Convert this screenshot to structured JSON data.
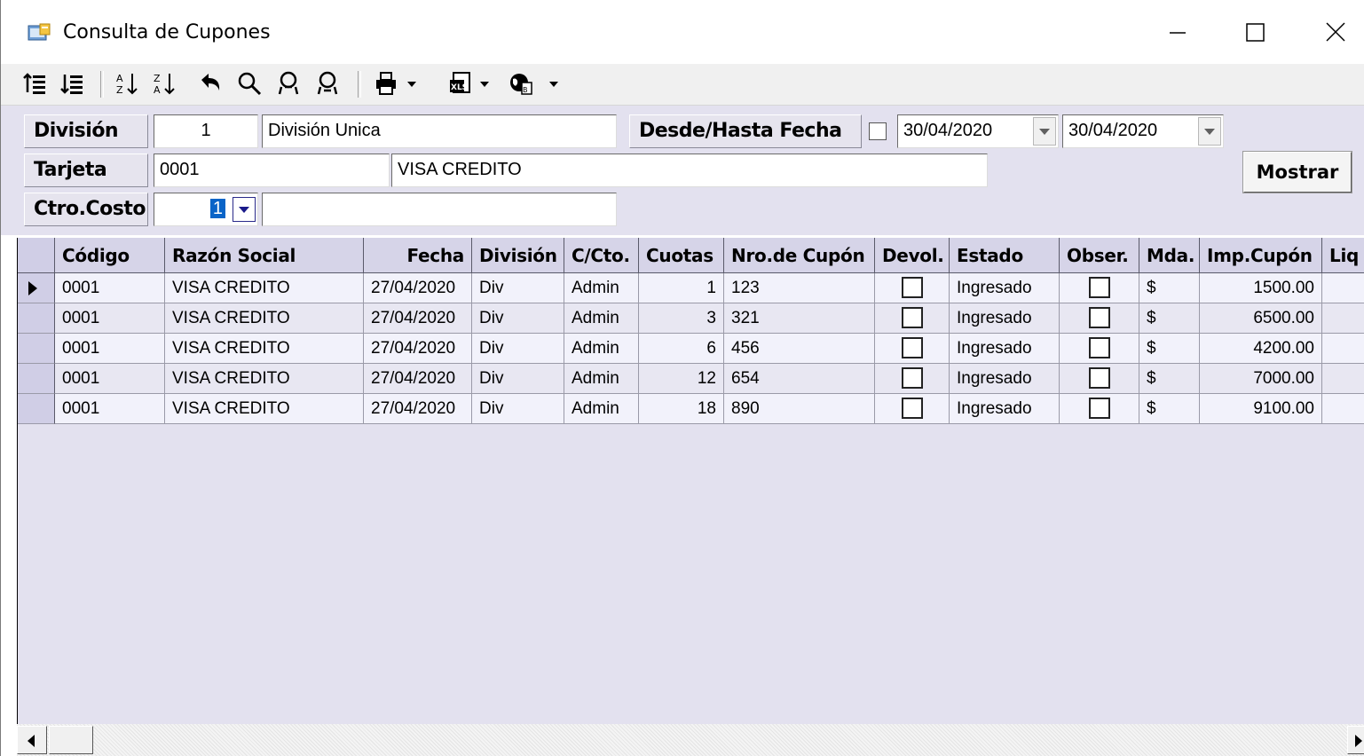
{
  "window": {
    "title": "Consulta de Cupones",
    "icons": {
      "app": "app-window-icon",
      "minimize": "minimize-icon",
      "maximize": "maximize-icon",
      "close": "close-icon"
    }
  },
  "toolbar": {
    "icons": [
      "indent-left-icon",
      "indent-right-icon",
      "sort-ascending-icon",
      "sort-descending-icon",
      "undo-icon",
      "find-icon",
      "find-all-icon",
      "find-next-icon",
      "print-icon",
      "export-excel-icon",
      "web-export-icon"
    ]
  },
  "filters": {
    "division_label": "División",
    "division_code": "1",
    "division_name": "División Unica",
    "date_range_label": "Desde/Hasta Fecha",
    "date_from": "30/04/2020",
    "date_to": "30/04/2020",
    "card_label": "Tarjeta",
    "card_code": "0001",
    "card_name": "VISA CREDITO",
    "cost_center_label": "Ctro.Costo",
    "cost_center_value": "1",
    "cost_center_name": "",
    "show_button": "Mostrar"
  },
  "grid": {
    "columns": [
      "Código",
      "Razón Social",
      "Fecha",
      "División",
      "C/Cto.",
      "Cuotas",
      "Nro.de Cupón",
      "Devol.",
      "Estado",
      "Obser.",
      "Mda.",
      "Imp.Cupón",
      "Liq"
    ],
    "rows": [
      {
        "codigo": "0001",
        "razon_social": "VISA CREDITO",
        "fecha": "27/04/2020",
        "division": "Div",
        "ccto": "Admin",
        "cuotas": "1",
        "cupon": "123",
        "devol": false,
        "estado": "Ingresado",
        "obser": false,
        "mda": "$",
        "importe": "1500.00",
        "liq": ""
      },
      {
        "codigo": "0001",
        "razon_social": "VISA CREDITO",
        "fecha": "27/04/2020",
        "division": "Div",
        "ccto": "Admin",
        "cuotas": "3",
        "cupon": "321",
        "devol": false,
        "estado": "Ingresado",
        "obser": false,
        "mda": "$",
        "importe": "6500.00",
        "liq": ""
      },
      {
        "codigo": "0001",
        "razon_social": "VISA CREDITO",
        "fecha": "27/04/2020",
        "division": "Div",
        "ccto": "Admin",
        "cuotas": "6",
        "cupon": "456",
        "devol": false,
        "estado": "Ingresado",
        "obser": false,
        "mda": "$",
        "importe": "4200.00",
        "liq": ""
      },
      {
        "codigo": "0001",
        "razon_social": "VISA CREDITO",
        "fecha": "27/04/2020",
        "division": "Div",
        "ccto": "Admin",
        "cuotas": "12",
        "cupon": "654",
        "devol": false,
        "estado": "Ingresado",
        "obser": false,
        "mda": "$",
        "importe": "7000.00",
        "liq": ""
      },
      {
        "codigo": "0001",
        "razon_social": "VISA CREDITO",
        "fecha": "27/04/2020",
        "division": "Div",
        "ccto": "Admin",
        "cuotas": "18",
        "cupon": "890",
        "devol": false,
        "estado": "Ingresado",
        "obser": false,
        "mda": "$",
        "importe": "9100.00",
        "liq": ""
      }
    ]
  },
  "colors": {
    "panel_bg": "#e3e1ef",
    "header_bg": "#d6d4e8",
    "row_light": "#f2f2fb",
    "row_alt": "#e8e7f2"
  }
}
